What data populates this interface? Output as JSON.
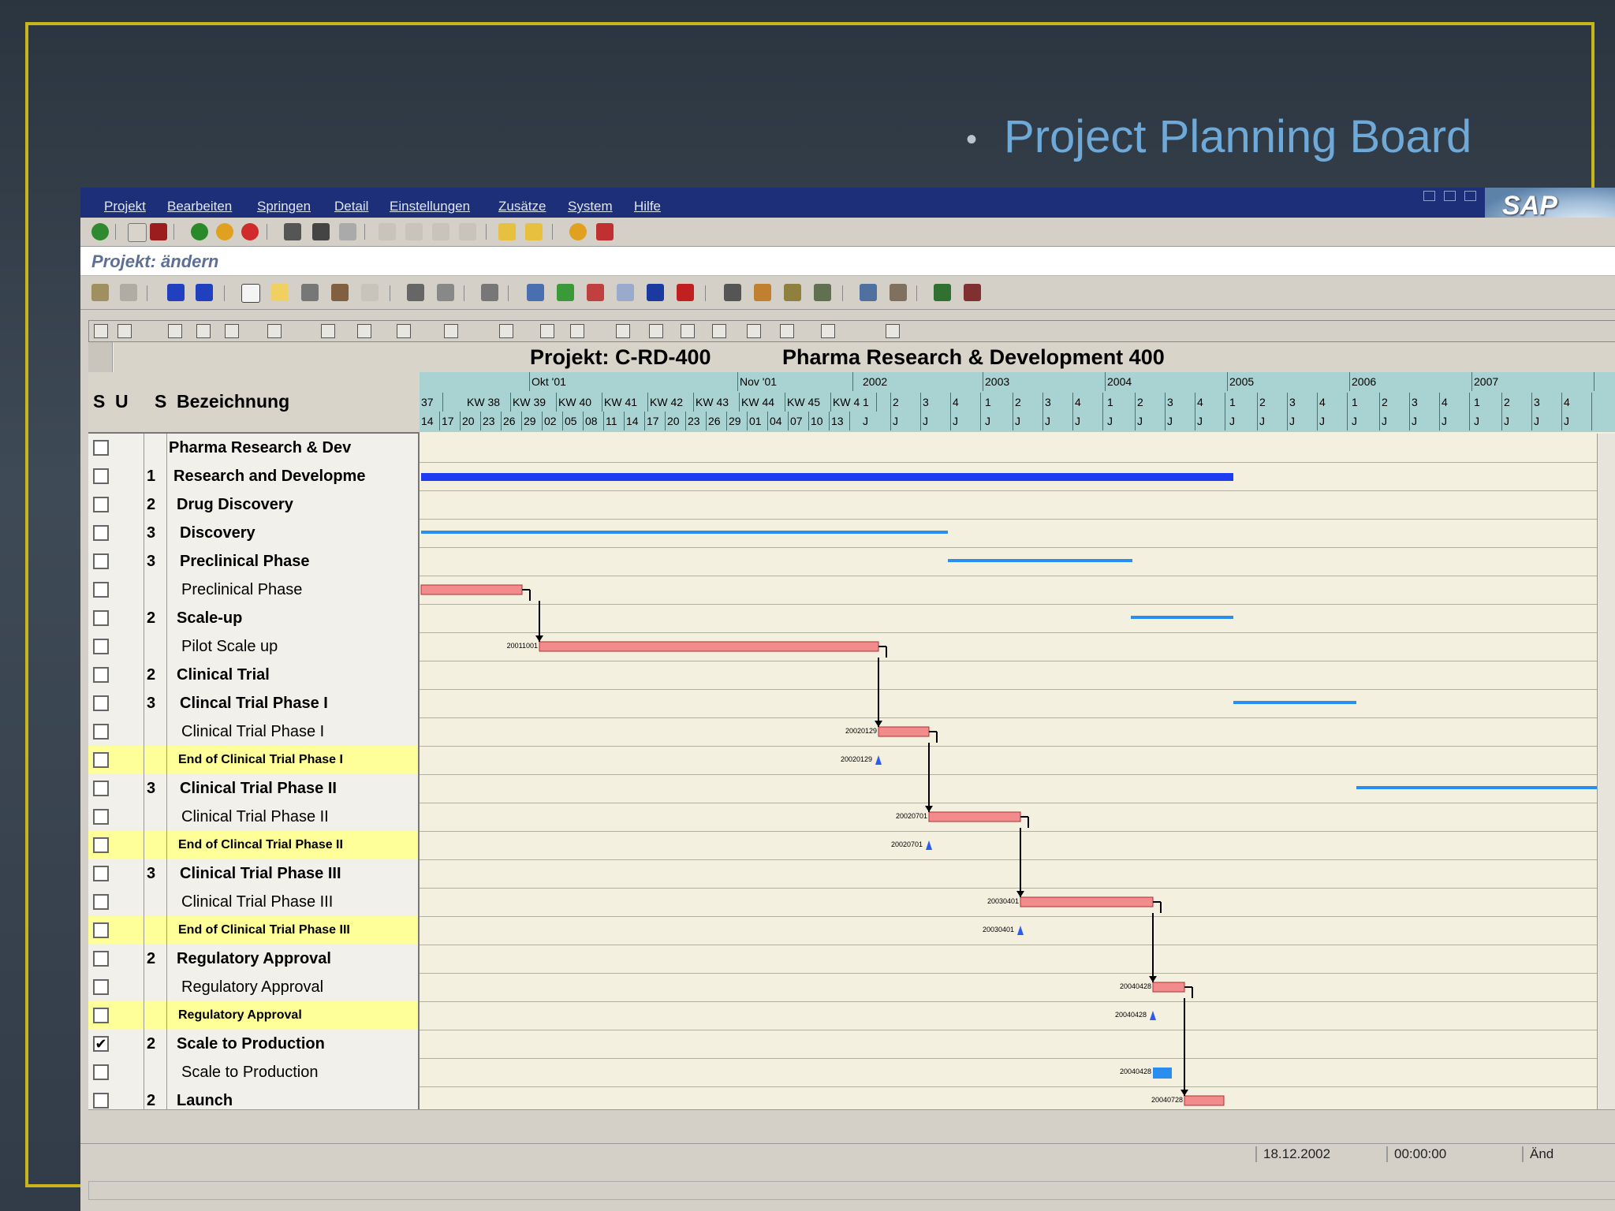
{
  "slide": {
    "bullet": "•",
    "title": "Project Planning Board"
  },
  "menu": [
    "Projekt",
    "Bearbeiten",
    "Springen",
    "Detail",
    "Einstellungen",
    "Zusätze",
    "System",
    "Hilfe"
  ],
  "sap_logo": "SAP",
  "screen_title": "Projekt: ändern",
  "gantt": {
    "project_label": "Projekt: C-RD-400",
    "project_name": "Pharma Research & Development 400",
    "columns": {
      "s1": "S",
      "u": "U",
      "s2": "S",
      "name": "Bezeichnung"
    },
    "timeline": {
      "months": [
        "Okt '01",
        "Nov '01"
      ],
      "years": [
        "2002",
        "2003",
        "2004",
        "2005",
        "2006",
        "2007"
      ],
      "weeks": [
        "37",
        "KW 38",
        "KW 39",
        "KW 40",
        "KW 41",
        "KW 42",
        "KW 43",
        "KW 44",
        "KW 45",
        "KW 4"
      ],
      "days": [
        "14",
        "17",
        "20",
        "23",
        "26",
        "29",
        "02",
        "05",
        "08",
        "11",
        "14",
        "17",
        "20",
        "23",
        "26",
        "29",
        "01",
        "04",
        "07",
        "10",
        "13"
      ],
      "quarters": [
        "1",
        "2",
        "3",
        "4"
      ],
      "quarter_marker": "J"
    },
    "rows": [
      {
        "level": "",
        "name": "Pharma Research & Dev",
        "bold": true,
        "checked": false,
        "yellow": false
      },
      {
        "level": "1",
        "name": "Research and Developme",
        "bold": true,
        "checked": false,
        "yellow": false
      },
      {
        "level": "2",
        "name": "Drug Discovery",
        "bold": true,
        "checked": false,
        "yellow": false
      },
      {
        "level": "3",
        "name": "Discovery",
        "bold": true,
        "checked": false,
        "yellow": false
      },
      {
        "level": "3",
        "name": "Preclinical Phase",
        "bold": true,
        "checked": false,
        "yellow": false
      },
      {
        "level": "",
        "name": "Preclinical Phase",
        "bold": false,
        "checked": false,
        "yellow": false
      },
      {
        "level": "2",
        "name": "Scale-up",
        "bold": true,
        "checked": false,
        "yellow": false
      },
      {
        "level": "",
        "name": "Pilot Scale up",
        "bold": false,
        "checked": false,
        "yellow": false
      },
      {
        "level": "2",
        "name": "Clinical Trial",
        "bold": true,
        "checked": false,
        "yellow": false
      },
      {
        "level": "3",
        "name": "Clincal Trial Phase I",
        "bold": true,
        "checked": false,
        "yellow": false
      },
      {
        "level": "",
        "name": "Clinical Trial Phase I",
        "bold": false,
        "checked": false,
        "yellow": false
      },
      {
        "level": "",
        "name": "End of Clinical Trial Phase I",
        "bold": true,
        "checked": false,
        "yellow": true
      },
      {
        "level": "3",
        "name": "Clinical Trial Phase II",
        "bold": true,
        "checked": false,
        "yellow": false
      },
      {
        "level": "",
        "name": "Clinical Trial Phase II",
        "bold": false,
        "checked": false,
        "yellow": false
      },
      {
        "level": "",
        "name": "End of Clincal Trial Phase II",
        "bold": true,
        "checked": false,
        "yellow": true
      },
      {
        "level": "3",
        "name": "Clinical Trial Phase III",
        "bold": true,
        "checked": false,
        "yellow": false
      },
      {
        "level": "",
        "name": "Clinical Trial Phase III",
        "bold": false,
        "checked": false,
        "yellow": false
      },
      {
        "level": "",
        "name": "End of Clinical Trial Phase III",
        "bold": true,
        "checked": false,
        "yellow": true
      },
      {
        "level": "2",
        "name": "Regulatory Approval",
        "bold": true,
        "checked": false,
        "yellow": false
      },
      {
        "level": "",
        "name": "Regulatory Approval",
        "bold": false,
        "checked": false,
        "yellow": false
      },
      {
        "level": "",
        "name": "Regulatory Approval",
        "bold": true,
        "checked": false,
        "yellow": true
      },
      {
        "level": "2",
        "name": "Scale to Production",
        "bold": true,
        "checked": true,
        "yellow": false
      },
      {
        "level": "",
        "name": "Scale to Production",
        "bold": false,
        "checked": false,
        "yellow": false
      },
      {
        "level": "2",
        "name": "Launch",
        "bold": true,
        "checked": false,
        "yellow": false
      }
    ],
    "date_labels": [
      "20011001",
      "20020129",
      "20020129",
      "20020701",
      "20020701",
      "20030401",
      "20030401",
      "20040428",
      "20040428",
      "20040428",
      "20040728"
    ]
  },
  "status": {
    "date": "18.12.2002",
    "time": "00:00:00",
    "mode": "Änd"
  },
  "colors": {
    "summary_bar": "#1e3cf0",
    "phase_line": "#2a8ef0",
    "task_bar": "#f28b8b",
    "milestone": "#2a5cf0",
    "highlight": "#ffff99"
  }
}
